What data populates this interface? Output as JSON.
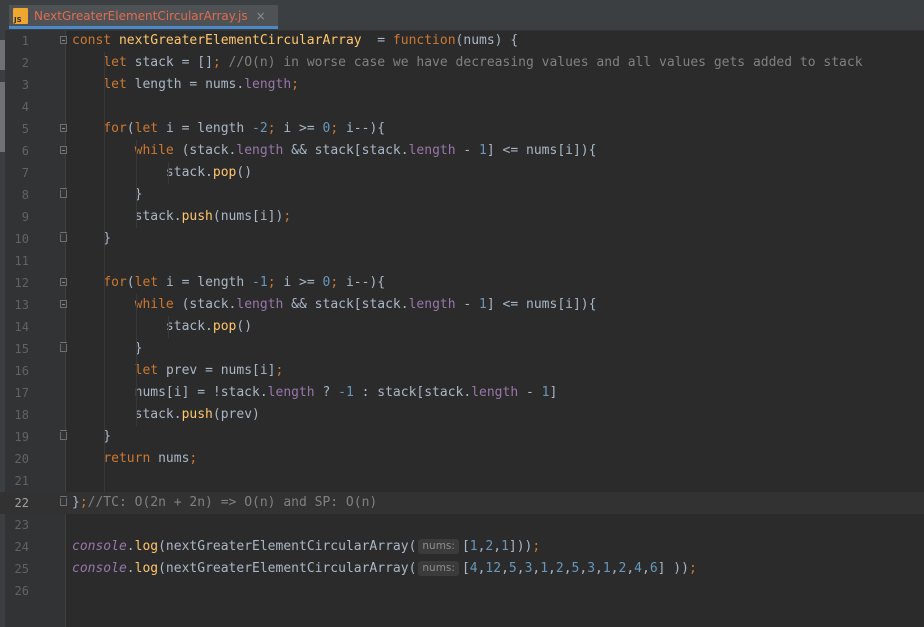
{
  "tab": {
    "title": "NextGreaterElementCircularArray.js",
    "close": "×",
    "icon": "js-file-icon"
  },
  "current_line": 22,
  "lines": [
    {
      "n": "1",
      "fold": "open",
      "tokens": [
        [
          "kw",
          "const "
        ],
        [
          "fn",
          "nextGreaterElementCircularArray"
        ],
        [
          "",
          "  = "
        ],
        [
          "kw",
          "function"
        ],
        [
          "",
          "(nums) {"
        ]
      ]
    },
    {
      "n": "2",
      "tokens": [
        [
          "",
          "    "
        ],
        [
          "kw",
          "let "
        ],
        [
          "",
          "stack = []"
        ],
        [
          "kw",
          ";"
        ],
        [
          "cmt",
          " //O(n) in worse case we have decreasing values and all values gets added to stack"
        ]
      ]
    },
    {
      "n": "3",
      "tokens": [
        [
          "",
          "    "
        ],
        [
          "kw",
          "let "
        ],
        [
          "",
          "length = nums."
        ],
        [
          "prop",
          "length"
        ],
        [
          "kw",
          ";"
        ]
      ]
    },
    {
      "n": "4",
      "tokens": []
    },
    {
      "n": "5",
      "fold": "open",
      "tokens": [
        [
          "",
          "    "
        ],
        [
          "kw",
          "for"
        ],
        [
          "",
          "("
        ],
        [
          "kw",
          "let "
        ],
        [
          "",
          "i = length "
        ],
        [
          "num",
          "-2"
        ],
        [
          "kw",
          ";"
        ],
        [
          "",
          " i >= "
        ],
        [
          "num",
          "0"
        ],
        [
          "kw",
          ";"
        ],
        [
          "",
          " i--){"
        ]
      ]
    },
    {
      "n": "6",
      "fold": "open",
      "tokens": [
        [
          "",
          "        "
        ],
        [
          "kw",
          "while "
        ],
        [
          "",
          "(stack."
        ],
        [
          "prop",
          "length"
        ],
        [
          "",
          " && stack[stack."
        ],
        [
          "prop",
          "length"
        ],
        [
          "",
          " - "
        ],
        [
          "num",
          "1"
        ],
        [
          "",
          "] <= nums[i]){"
        ]
      ]
    },
    {
      "n": "7",
      "tokens": [
        [
          "",
          "            stack."
        ],
        [
          "fn",
          "pop"
        ],
        [
          "",
          "()"
        ]
      ]
    },
    {
      "n": "8",
      "fold": "end",
      "tokens": [
        [
          "",
          "        }"
        ]
      ]
    },
    {
      "n": "9",
      "tokens": [
        [
          "",
          "        stack."
        ],
        [
          "fn",
          "push"
        ],
        [
          "",
          "(nums[i])"
        ],
        [
          "kw",
          ";"
        ]
      ]
    },
    {
      "n": "10",
      "fold": "end",
      "tokens": [
        [
          "",
          "    }"
        ]
      ]
    },
    {
      "n": "11",
      "tokens": []
    },
    {
      "n": "12",
      "fold": "open",
      "tokens": [
        [
          "",
          "    "
        ],
        [
          "kw",
          "for"
        ],
        [
          "",
          "("
        ],
        [
          "kw",
          "let "
        ],
        [
          "",
          "i = length "
        ],
        [
          "num",
          "-1"
        ],
        [
          "kw",
          ";"
        ],
        [
          "",
          " i >= "
        ],
        [
          "num",
          "0"
        ],
        [
          "kw",
          ";"
        ],
        [
          "",
          " i--){"
        ]
      ]
    },
    {
      "n": "13",
      "fold": "open",
      "tokens": [
        [
          "",
          "        "
        ],
        [
          "kw",
          "while "
        ],
        [
          "",
          "(stack."
        ],
        [
          "prop",
          "length"
        ],
        [
          "",
          " && stack[stack."
        ],
        [
          "prop",
          "length"
        ],
        [
          "",
          " - "
        ],
        [
          "num",
          "1"
        ],
        [
          "",
          "] <= nums[i]){"
        ]
      ]
    },
    {
      "n": "14",
      "tokens": [
        [
          "",
          "            stack."
        ],
        [
          "fn",
          "pop"
        ],
        [
          "",
          "()"
        ]
      ]
    },
    {
      "n": "15",
      "fold": "end",
      "tokens": [
        [
          "",
          "        }"
        ]
      ]
    },
    {
      "n": "16",
      "tokens": [
        [
          "",
          "        "
        ],
        [
          "kw",
          "let "
        ],
        [
          "",
          "prev = nums[i]"
        ],
        [
          "kw",
          ";"
        ]
      ]
    },
    {
      "n": "17",
      "tokens": [
        [
          "",
          "        nums[i] = !stack."
        ],
        [
          "prop",
          "length"
        ],
        [
          "",
          " ? "
        ],
        [
          "num",
          "-1"
        ],
        [
          "",
          " : stack[stack."
        ],
        [
          "prop",
          "length"
        ],
        [
          "",
          " - "
        ],
        [
          "num",
          "1"
        ],
        [
          "",
          "]"
        ]
      ]
    },
    {
      "n": "18",
      "tokens": [
        [
          "",
          "        stack."
        ],
        [
          "fn",
          "push"
        ],
        [
          "",
          "(prev)"
        ]
      ]
    },
    {
      "n": "19",
      "fold": "end",
      "tokens": [
        [
          "",
          "    }"
        ]
      ]
    },
    {
      "n": "20",
      "tokens": [
        [
          "",
          "    "
        ],
        [
          "kw",
          "return "
        ],
        [
          "",
          "nums"
        ],
        [
          "kw",
          ";"
        ]
      ]
    },
    {
      "n": "21",
      "tokens": []
    },
    {
      "n": "22",
      "fold": "end",
      "tokens": [
        [
          "",
          "}"
        ],
        [
          "kw",
          ";"
        ],
        [
          "cmt",
          "//TC: O(2n + 2n) => O(n) and SP: O(n)"
        ]
      ]
    },
    {
      "n": "23",
      "tokens": []
    },
    {
      "n": "24",
      "tokens": [
        [
          "con",
          "console"
        ],
        [
          "",
          "."
        ],
        [
          "fn",
          "log"
        ],
        [
          "",
          "(nextGreaterElementCircularArray("
        ],
        [
          "hint",
          "nums:"
        ],
        [
          "",
          "["
        ],
        [
          "num",
          "1"
        ],
        [
          "",
          ","
        ],
        [
          "num",
          "2"
        ],
        [
          "",
          ","
        ],
        [
          "num",
          "1"
        ],
        [
          "",
          "]))"
        ],
        [
          "kw",
          ";"
        ]
      ]
    },
    {
      "n": "25",
      "tokens": [
        [
          "con",
          "console"
        ],
        [
          "",
          "."
        ],
        [
          "fn",
          "log"
        ],
        [
          "",
          "(nextGreaterElementCircularArray("
        ],
        [
          "hint",
          "nums:"
        ],
        [
          "",
          "["
        ],
        [
          "num",
          "4"
        ],
        [
          "",
          ","
        ],
        [
          "num",
          "12"
        ],
        [
          "",
          ","
        ],
        [
          "num",
          "5"
        ],
        [
          "",
          ","
        ],
        [
          "num",
          "3"
        ],
        [
          "",
          ","
        ],
        [
          "num",
          "1"
        ],
        [
          "",
          ","
        ],
        [
          "num",
          "2"
        ],
        [
          "",
          ","
        ],
        [
          "num",
          "5"
        ],
        [
          "",
          ","
        ],
        [
          "num",
          "3"
        ],
        [
          "",
          ","
        ],
        [
          "num",
          "1"
        ],
        [
          "",
          ","
        ],
        [
          "num",
          "2"
        ],
        [
          "",
          ","
        ],
        [
          "num",
          "4"
        ],
        [
          "",
          ","
        ],
        [
          "num",
          "6"
        ],
        [
          "",
          "] ))"
        ],
        [
          "kw",
          ";"
        ]
      ]
    },
    {
      "n": "26",
      "tokens": []
    }
  ]
}
